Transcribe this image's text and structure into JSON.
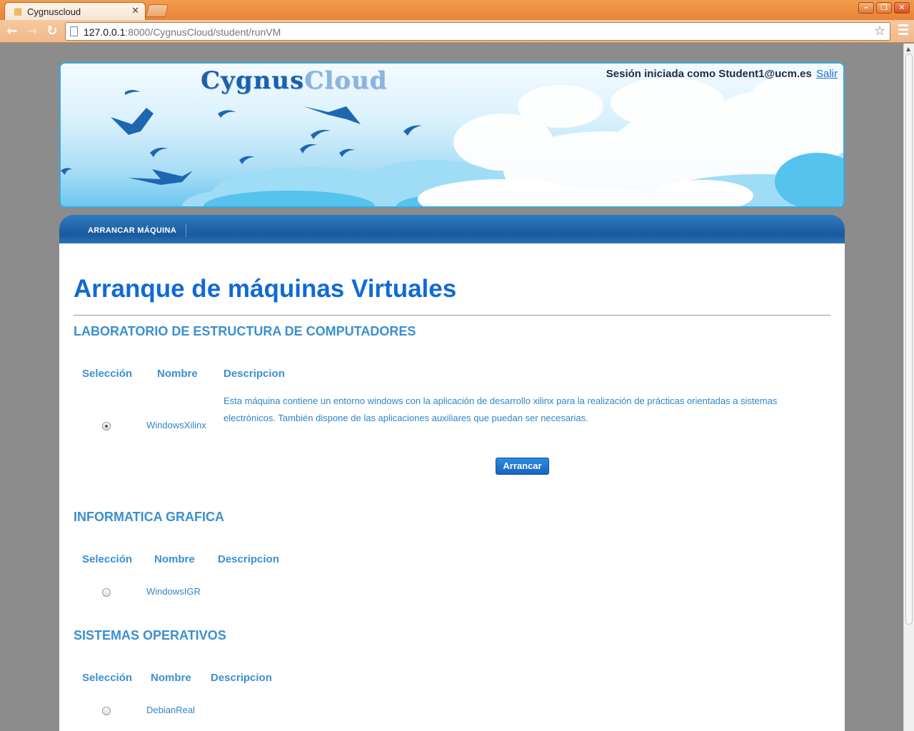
{
  "browser": {
    "tab_title": "Cygnuscloud",
    "url_host": "127.0.0.1",
    "url_rest": ":8000/CygnusCloud/student/runVM"
  },
  "header": {
    "logo_main": "Cygnus",
    "logo_cloud": "Cloud",
    "session_text": "Sesión iniciada como Student1@ucm.es",
    "logout_label": "Salir"
  },
  "nav": {
    "items": [
      "ARRANCAR MÁQUINA"
    ]
  },
  "page": {
    "title": "Arranque de máquinas Virtuales",
    "start_button_label": "Arrancar"
  },
  "columns": {
    "selection": "Selección",
    "name": "Nombre",
    "description": "Descripcion"
  },
  "sections": [
    {
      "title": "LABORATORIO DE ESTRUCTURA DE COMPUTADORES",
      "vms": [
        {
          "name": "WindowsXilinx",
          "description": "Esta máquina contiene un entorno windows con la aplicación de desarrollo xilinx para la realización de prácticas orientadas a sistemas electrónicos. También dispone de las aplicaciones auxiliares que puedan ser necesarias.",
          "selected": true
        }
      ]
    },
    {
      "title": "INFORMATICA GRAFICA",
      "vms": [
        {
          "name": "WindowsIGR",
          "description": "",
          "selected": false
        }
      ]
    },
    {
      "title": "SISTEMAS OPERATIVOS",
      "vms": [
        {
          "name": "DebianReal",
          "description": "",
          "selected": false
        }
      ]
    }
  ],
  "colors": {
    "accent": "#3b8fcf",
    "title": "#0f6ad6",
    "chrome_orange": "#e8833a"
  },
  "icons": {
    "back": "arrow-left-icon",
    "forward": "arrow-right-icon",
    "reload": "reload-icon",
    "bookmark": "star-icon",
    "menu": "hamburger-menu-icon"
  }
}
